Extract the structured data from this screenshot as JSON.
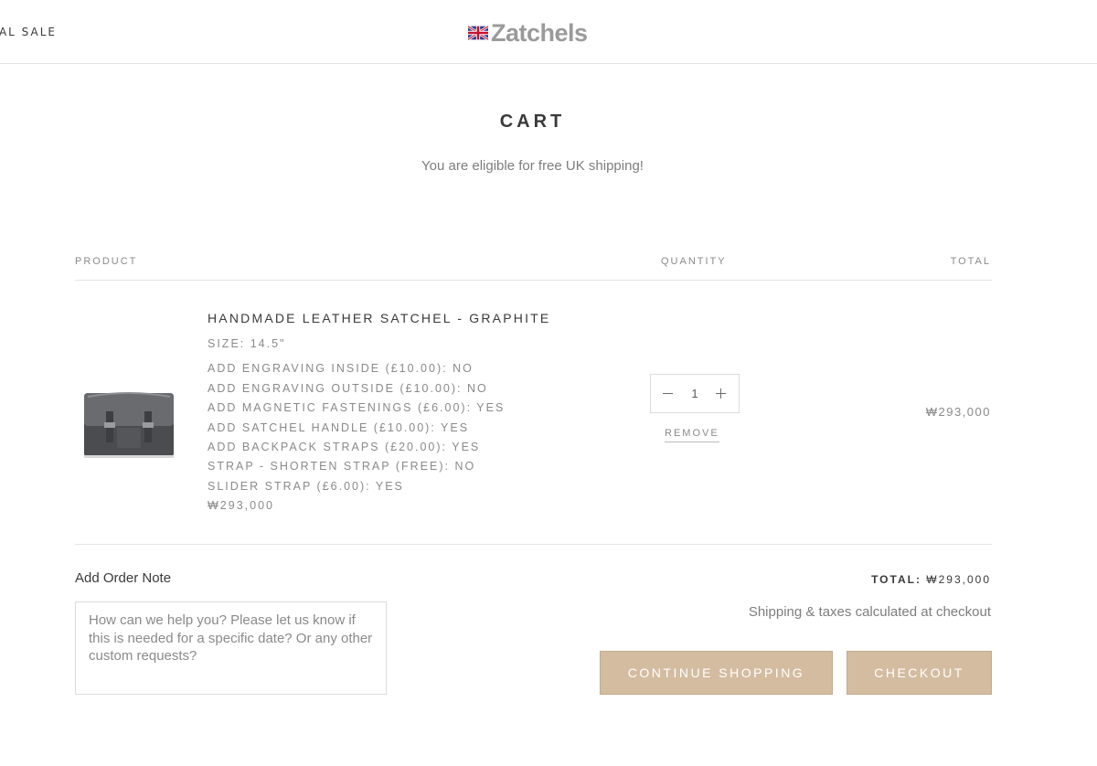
{
  "header": {
    "nav_sale": "NAL SALE",
    "logo_text": "Zatchels",
    "flag_icon": "union-jack-flag-icon"
  },
  "page": {
    "title": "CART",
    "shipping_message": "You are eligible for free UK shipping!"
  },
  "table": {
    "col_product": "PRODUCT",
    "col_quantity": "QUANTITY",
    "col_total": "TOTAL"
  },
  "item": {
    "title": "HANDMADE LEATHER SATCHEL - GRAPHITE",
    "size": "SIZE: 14.5\"",
    "options": [
      "ADD ENGRAVING INSIDE (£10.00): NO",
      "ADD ENGRAVING OUTSIDE (£10.00): NO",
      "ADD MAGNETIC FASTENINGS (£6.00): YES",
      "ADD SATCHEL HANDLE (£10.00): YES",
      "ADD BACKPACK STRAPS (£20.00): YES",
      "STRAP - SHORTEN STRAP (FREE): NO",
      "SLIDER STRAP (£6.00): YES"
    ],
    "price": "₩293,000",
    "quantity": "1",
    "remove_label": "REMOVE",
    "line_total": "₩293,000",
    "image_color": "#5e5f62"
  },
  "note": {
    "label": "Add Order Note",
    "placeholder": "How can we help you? Please let us know if this is needed for a specific date? Or any other custom requests?"
  },
  "summary": {
    "total_label": "TOTAL:",
    "total_value": "₩293,000",
    "tax_message": "Shipping & taxes calculated at checkout"
  },
  "actions": {
    "continue_label": "CONTINUE SHOPPING",
    "checkout_label": "CHECKOUT"
  },
  "colors": {
    "button_bg": "#d4bca1",
    "text_primary": "#3a3a3a",
    "text_muted": "#8a8a8a"
  }
}
